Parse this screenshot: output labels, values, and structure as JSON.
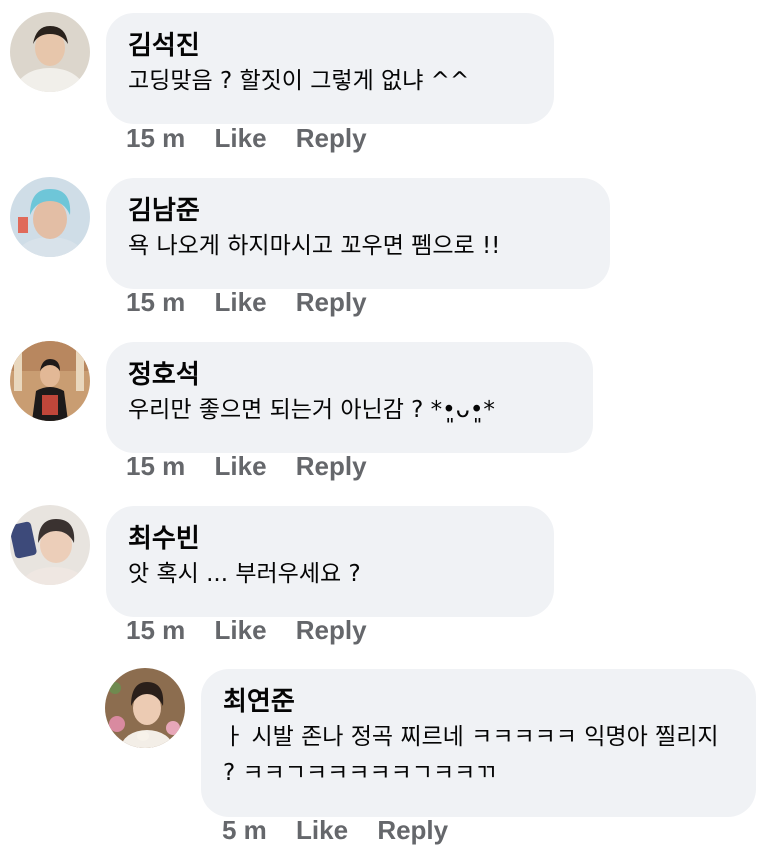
{
  "comments": [
    {
      "author": "김석진",
      "text": "고딩맞음 ? 할짓이 그렇게 없냐 ^^",
      "time": "15 m",
      "like": "Like",
      "reply": "Reply",
      "avatar_colors": [
        "#d9d2c6",
        "#2a221c",
        "#e8c7ad"
      ]
    },
    {
      "author": "김남준",
      "text": "욕 나오게 하지마시고 꼬우면 펨으로 !!",
      "time": "15 m",
      "like": "Like",
      "reply": "Reply",
      "avatar_colors": [
        "#c9d8e4",
        "#6fc7d9",
        "#e6c1a8"
      ]
    },
    {
      "author": "정호석",
      "text": "우리만 좋으면 되는거 아닌감 ? *•͈ᴗ•͈*",
      "time": "15 m",
      "like": "Like",
      "reply": "Reply",
      "avatar_colors": [
        "#c89a6e",
        "#1e1a1a",
        "#b84a3c"
      ]
    },
    {
      "author": "최수빈",
      "text": "앗 혹시 ... 부러우세요 ?",
      "time": "15 m",
      "like": "Like",
      "reply": "Reply",
      "avatar_colors": [
        "#e7e3de",
        "#3a3230",
        "#e8c9b5"
      ]
    },
    {
      "author": "최연준",
      "text": "ㅏ 시발 존나 정곡 찌르네 ㅋㅋㅋㅋㅋ 익명아 찔리지 ? ㅋㅋㄱㅋㅋㅋㅋㅋㄱㅋㅋㄲ",
      "time": "5 m",
      "like": "Like",
      "reply": "Reply",
      "avatar_colors": [
        "#9a7a5a",
        "#2a1f1a",
        "#f2ede6"
      ]
    }
  ]
}
